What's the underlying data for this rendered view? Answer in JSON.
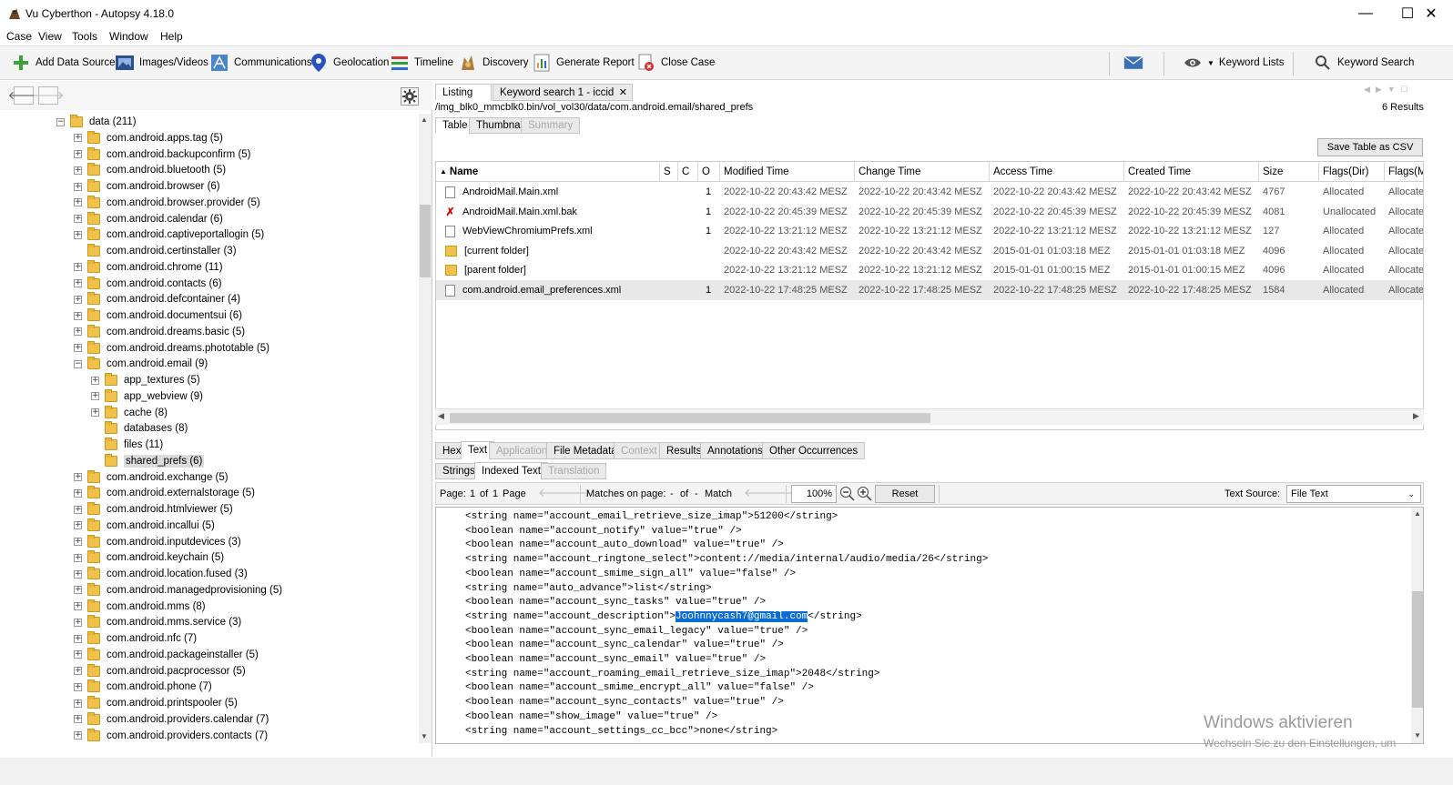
{
  "window": {
    "title": "Vu Cyberthon - Autopsy 4.18.0",
    "minimize": "—",
    "maximize": "☐",
    "close": "✕"
  },
  "menu": [
    "Case",
    "View",
    "Tools",
    "Window",
    "Help"
  ],
  "toolbar": {
    "items": [
      {
        "label": "Add Data Source",
        "icon": "plus-icon"
      },
      {
        "label": "Images/Videos",
        "icon": "images-icon"
      },
      {
        "label": "Communications",
        "icon": "communications-icon"
      },
      {
        "label": "Geolocation",
        "icon": "map-pin-icon"
      },
      {
        "label": "Timeline",
        "icon": "timeline-icon"
      },
      {
        "label": "Discovery",
        "icon": "discovery-icon"
      },
      {
        "label": "Generate Report",
        "icon": "report-icon"
      },
      {
        "label": "Close Case",
        "icon": "close-case-icon"
      }
    ],
    "keyword_lists": "Keyword Lists",
    "keyword_search": "Keyword Search"
  },
  "tree": [
    {
      "label": "data (211)",
      "level": 0,
      "expanded": true
    },
    {
      "label": "com.android.apps.tag (5)",
      "level": 1
    },
    {
      "label": "com.android.backupconfirm (5)",
      "level": 1
    },
    {
      "label": "com.android.bluetooth (5)",
      "level": 1
    },
    {
      "label": "com.android.browser (6)",
      "level": 1
    },
    {
      "label": "com.android.browser.provider (5)",
      "level": 1
    },
    {
      "label": "com.android.calendar (6)",
      "level": 1
    },
    {
      "label": "com.android.captiveportallogin (5)",
      "level": 1
    },
    {
      "label": "com.android.certinstaller (3)",
      "level": 1,
      "leaf": true
    },
    {
      "label": "com.android.chrome (11)",
      "level": 1
    },
    {
      "label": "com.android.contacts (6)",
      "level": 1
    },
    {
      "label": "com.android.defcontainer (4)",
      "level": 1
    },
    {
      "label": "com.android.documentsui (6)",
      "level": 1
    },
    {
      "label": "com.android.dreams.basic (5)",
      "level": 1
    },
    {
      "label": "com.android.dreams.phototable (5)",
      "level": 1
    },
    {
      "label": "com.android.email (9)",
      "level": 1,
      "expanded": true
    },
    {
      "label": "app_textures (5)",
      "level": 2
    },
    {
      "label": "app_webview (9)",
      "level": 2
    },
    {
      "label": "cache (8)",
      "level": 2
    },
    {
      "label": "databases (8)",
      "level": 2,
      "leaf": true
    },
    {
      "label": "files (11)",
      "level": 2,
      "leaf": true
    },
    {
      "label": "shared_prefs (6)",
      "level": 2,
      "leaf": true,
      "selected": true
    },
    {
      "label": "com.android.exchange (5)",
      "level": 1
    },
    {
      "label": "com.android.externalstorage (5)",
      "level": 1
    },
    {
      "label": "com.android.htmlviewer (5)",
      "level": 1
    },
    {
      "label": "com.android.incallui (5)",
      "level": 1
    },
    {
      "label": "com.android.inputdevices (3)",
      "level": 1
    },
    {
      "label": "com.android.keychain (5)",
      "level": 1
    },
    {
      "label": "com.android.location.fused (3)",
      "level": 1
    },
    {
      "label": "com.android.managedprovisioning (5)",
      "level": 1
    },
    {
      "label": "com.android.mms (8)",
      "level": 1
    },
    {
      "label": "com.android.mms.service (3)",
      "level": 1
    },
    {
      "label": "com.android.nfc (7)",
      "level": 1
    },
    {
      "label": "com.android.packageinstaller (5)",
      "level": 1
    },
    {
      "label": "com.android.pacprocessor (5)",
      "level": 1
    },
    {
      "label": "com.android.phone (7)",
      "level": 1
    },
    {
      "label": "com.android.printspooler (5)",
      "level": 1
    },
    {
      "label": "com.android.providers.calendar (7)",
      "level": 1
    },
    {
      "label": "com.android.providers.contacts (7)",
      "level": 1
    }
  ],
  "result_tabs": [
    {
      "label": "Listing",
      "active": true
    },
    {
      "label": "Keyword search 1 - iccid",
      "active": false
    }
  ],
  "path": "/img_blk0_mmcblk0.bin/vol_vol30/data/com.android.email/shared_prefs",
  "results_count": "6  Results",
  "view_tabs": [
    {
      "label": "Table",
      "active": true
    },
    {
      "label": "Thumbnail",
      "active": false
    },
    {
      "label": "Summary",
      "active": false,
      "disabled": true
    }
  ],
  "save_csv": "Save Table as CSV",
  "table": {
    "headers": [
      "Name",
      "S",
      "C",
      "O",
      "Modified Time",
      "Change Time",
      "Access Time",
      "Created Time",
      "Size",
      "Flags(Dir)",
      "Flags(M"
    ],
    "rows": [
      {
        "icon": "file",
        "name": "AndroidMail.Main.xml",
        "o": "1",
        "mod": "2022-10-22 20:43:42 MESZ",
        "chg": "2022-10-22 20:43:42 MESZ",
        "acc": "2022-10-22 20:43:42 MESZ",
        "crt": "2022-10-22 20:43:42 MESZ",
        "size": "4767",
        "flags": "Allocated",
        "flagsm": "Allocate"
      },
      {
        "icon": "deleted",
        "name": "AndroidMail.Main.xml.bak",
        "o": "1",
        "mod": "2022-10-22 20:45:39 MESZ",
        "chg": "2022-10-22 20:45:39 MESZ",
        "acc": "2022-10-22 20:45:39 MESZ",
        "crt": "2022-10-22 20:45:39 MESZ",
        "size": "4081",
        "flags": "Unallocated",
        "flagsm": "Allocate"
      },
      {
        "icon": "file",
        "name": "WebViewChromiumPrefs.xml",
        "o": "1",
        "mod": "2022-10-22 13:21:12 MESZ",
        "chg": "2022-10-22 13:21:12 MESZ",
        "acc": "2022-10-22 13:21:12 MESZ",
        "crt": "2022-10-22 13:21:12 MESZ",
        "size": "127",
        "flags": "Allocated",
        "flagsm": "Allocate"
      },
      {
        "icon": "folder",
        "name": "[current folder]",
        "o": "",
        "mod": "2022-10-22 20:43:42 MESZ",
        "chg": "2022-10-22 20:43:42 MESZ",
        "acc": "2015-01-01 01:03:18 MEZ",
        "crt": "2015-01-01 01:03:18 MEZ",
        "size": "4096",
        "flags": "Allocated",
        "flagsm": "Allocate"
      },
      {
        "icon": "folder",
        "name": "[parent folder]",
        "o": "",
        "mod": "2022-10-22 13:21:12 MESZ",
        "chg": "2022-10-22 13:21:12 MESZ",
        "acc": "2015-01-01 01:00:15 MEZ",
        "crt": "2015-01-01 01:00:15 MEZ",
        "size": "4096",
        "flags": "Allocated",
        "flagsm": "Allocate"
      },
      {
        "icon": "file",
        "name": "com.android.email_preferences.xml",
        "o": "1",
        "mod": "2022-10-22 17:48:25 MESZ",
        "chg": "2022-10-22 17:48:25 MESZ",
        "acc": "2022-10-22 17:48:25 MESZ",
        "crt": "2022-10-22 17:48:25 MESZ",
        "size": "1584",
        "flags": "Allocated",
        "flagsm": "Allocate",
        "selected": true
      }
    ]
  },
  "content_tabs": [
    {
      "label": "Hex",
      "active": false
    },
    {
      "label": "Text",
      "active": true
    },
    {
      "label": "Application",
      "active": false,
      "disabled": true
    },
    {
      "label": "File Metadata",
      "active": false
    },
    {
      "label": "Context",
      "active": false,
      "disabled": true
    },
    {
      "label": "Results",
      "active": false
    },
    {
      "label": "Annotations",
      "active": false
    },
    {
      "label": "Other Occurrences",
      "active": false
    }
  ],
  "text_tabs": [
    {
      "label": "Strings",
      "active": false
    },
    {
      "label": "Indexed Text",
      "active": true
    },
    {
      "label": "Translation",
      "active": false,
      "disabled": true
    }
  ],
  "text_controls": {
    "page_label": "Page:",
    "page_value": "1",
    "of_label": "of",
    "page_total": "1",
    "page_word": "Page",
    "matches_label": "Matches on page:",
    "matches_value": "-",
    "matches_of": "of",
    "matches_total": "-",
    "match_word": "Match",
    "zoom": "100%",
    "reset": "Reset",
    "text_source_label": "Text Source:",
    "text_source_value": "File Text"
  },
  "text_lines": [
    {
      "pre": "<string name=\"account_email_retrieve_size_imap\">51200</string>"
    },
    {
      "pre": "<boolean name=\"account_notify\" value=\"true\" />"
    },
    {
      "pre": "<boolean name=\"account_auto_download\" value=\"true\" />"
    },
    {
      "pre": "<string name=\"account_ringtone_select\">content://media/internal/audio/media/26</string>"
    },
    {
      "pre": "<boolean name=\"account_smime_sign_all\" value=\"false\" />"
    },
    {
      "pre": "<string name=\"auto_advance\">list</string>"
    },
    {
      "pre": "<boolean name=\"account_sync_tasks\" value=\"true\" />"
    },
    {
      "pre": "<string name=\"account_description\">",
      "hl": "Joohnnycash7@gmail.com",
      "post": "</string>"
    },
    {
      "pre": "<boolean name=\"account_sync_email_legacy\" value=\"true\" />"
    },
    {
      "pre": "<boolean name=\"account_sync_calendar\" value=\"true\" />"
    },
    {
      "pre": "<boolean name=\"account_sync_email\" value=\"true\" />"
    },
    {
      "pre": "<string name=\"account_roaming_email_retrieve_size_imap\">2048</string>"
    },
    {
      "pre": "<boolean name=\"account_smime_encrypt_all\" value=\"false\" />"
    },
    {
      "pre": "<boolean name=\"account_sync_contacts\" value=\"true\" />"
    },
    {
      "pre": "<boolean name=\"show_image\" value=\"true\" />"
    },
    {
      "pre": "<string name=\"account_settings_cc_bcc\">none</string>"
    }
  ],
  "watermark": {
    "line1": "Windows aktivieren",
    "line2": "Wechseln Sie zu den Einstellungen, um"
  }
}
